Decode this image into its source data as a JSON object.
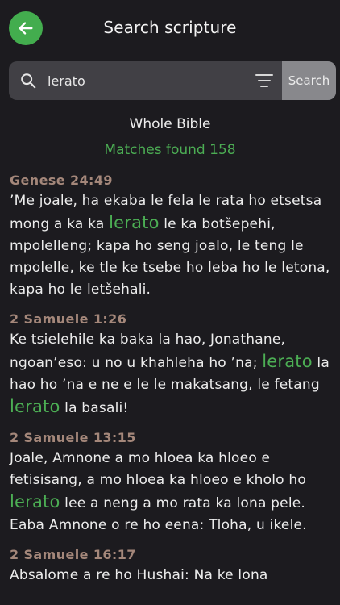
{
  "header": {
    "title": "Search scripture",
    "back_icon": "arrow-left-icon",
    "accent_color": "#43ad4e"
  },
  "search": {
    "value": "lerato",
    "button_label": "Search",
    "search_icon": "search-icon",
    "filter_icon": "filter-icon"
  },
  "scope": "Whole Bible",
  "matches": "Matches found 158",
  "highlight_color": "#4cae54",
  "results": [
    {
      "ref": "Genese 24:49",
      "parts": [
        "’Me joale, ha ekaba le fela le rata ho etsetsa mong a ka ka ",
        "lerato",
        " le ka botšepehi, mpolelleng; kapa ho seng joalo, le teng le mpolelle, ke tle ke tsebe ho leba ho le letona, kapa ho le letšehali."
      ]
    },
    {
      "ref": "2 Samuele 1:26",
      "parts": [
        "Ke tsielehile ka baka la hao, Jonathane, ngoan’eso: u no u khahleha ho ’na; ",
        "lerato",
        " la hao ho ’na e ne e le le makatsang, le fetang ",
        "lerato",
        " la basali!"
      ]
    },
    {
      "ref": "2 Samuele 13:15",
      "parts": [
        "Joale, Amnone a mo hloea ka hloeo e fetisisang, a mo hloea ka hloeo e kholo ho ",
        "lerato",
        " lee a neng a mo rata ka lona pele. Eaba Amnone o re ho eena: Tloha, u ikele."
      ]
    },
    {
      "ref": "2 Samuele 16:17",
      "parts": [
        "Absalome a re ho Hushai: Na ke lona"
      ]
    }
  ]
}
